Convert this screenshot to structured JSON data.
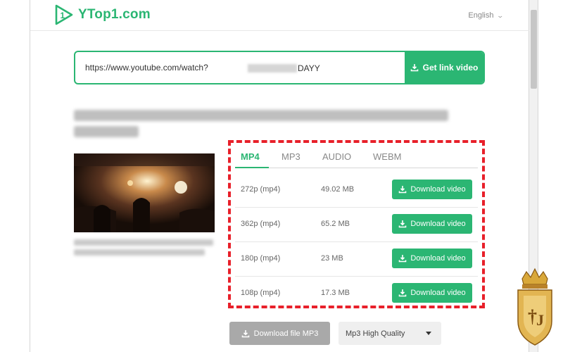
{
  "brand": {
    "name": "YTop1.com",
    "color": "#2bb673"
  },
  "header": {
    "language": "English"
  },
  "search": {
    "url_value": "https://www.youtube.com/watch?",
    "url_suffix": "DAYY",
    "button_label": "Get link video"
  },
  "video": {
    "thumbnail_icon": "concert-hall-thumbnail"
  },
  "tabs": [
    "MP4",
    "MP3",
    "AUDIO",
    "WEBM"
  ],
  "active_tab": "MP4",
  "formats": [
    {
      "quality": "272p (mp4)",
      "size": "49.02 MB",
      "action": "Download video"
    },
    {
      "quality": "362p (mp4)",
      "size": "65.2 MB",
      "action": "Download video"
    },
    {
      "quality": "180p (mp4)",
      "size": "23 MB",
      "action": "Download video"
    },
    {
      "quality": "108p (mp4)",
      "size": "17.3 MB",
      "action": "Download video"
    }
  ],
  "mp3": {
    "button_label": "Download file MP3",
    "quality_selected": "Mp3 High Quality"
  },
  "colors": {
    "accent": "#2bb673",
    "highlight": "#e8202a",
    "disabled": "#a9a9a9"
  },
  "icons": {
    "logo": "play-logo-icon",
    "download": "download-icon",
    "dropdown": "caret-down-icon",
    "corner_badge": "crown-badge-icon"
  }
}
